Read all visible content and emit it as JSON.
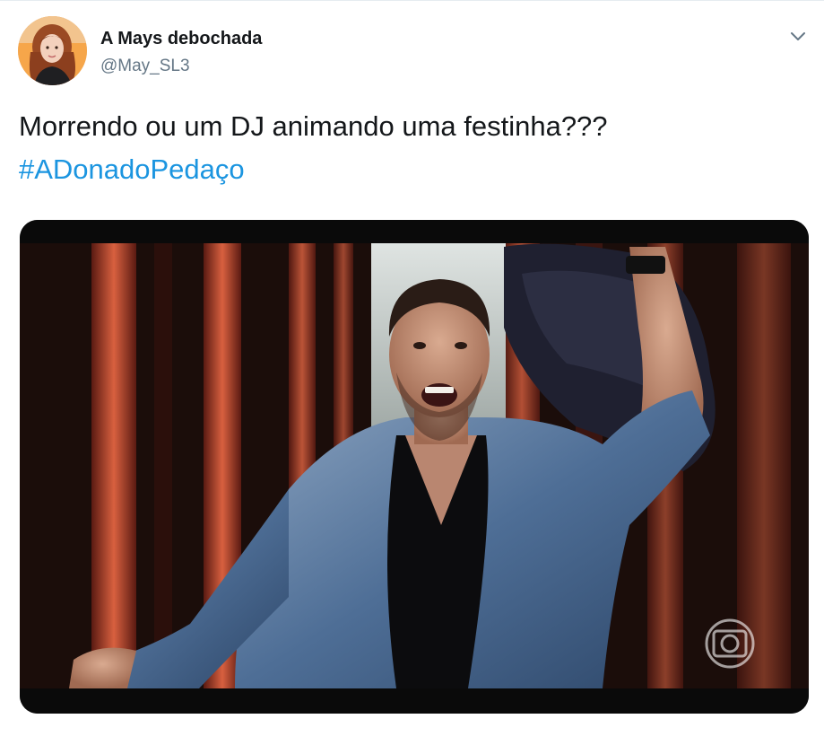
{
  "tweet": {
    "author": {
      "display_name": "A Mays debochada",
      "handle": "@May_SL3",
      "avatar": "avatar-photo"
    },
    "menu_icon": "chevron-down-icon",
    "text_line": "Morrendo ou um DJ animando uma festinha???",
    "hashtag": "#ADonadoPedaço",
    "media": {
      "kind": "video-still",
      "watermark": "globo-logo-icon"
    }
  },
  "colors": {
    "text_primary": "#14171a",
    "text_secondary": "#657786",
    "hashtag_link": "#1b95e0",
    "border": "#e6ecf0"
  }
}
